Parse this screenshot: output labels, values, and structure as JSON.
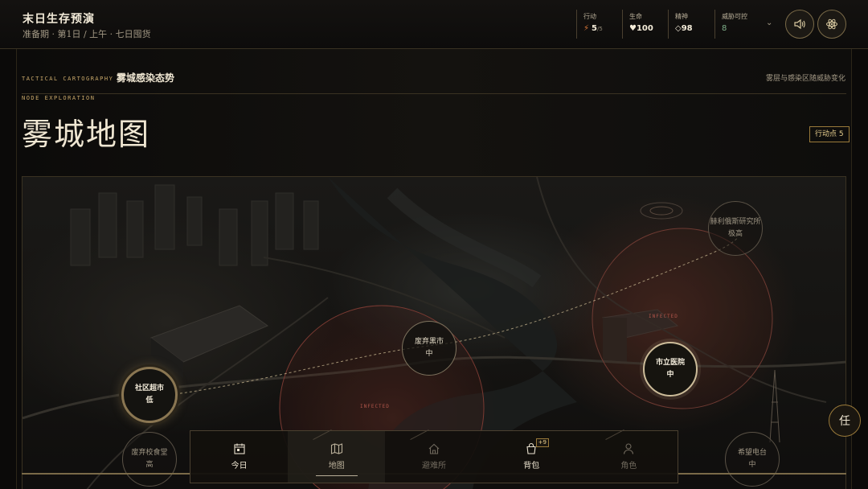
{
  "app": {
    "title": "末日生存预演",
    "subtitle": "准备期 · 第1日 / 上午 · 七日囤货"
  },
  "stats": [
    {
      "label": "行动",
      "value": "5",
      "max": "/5",
      "icon": "lightning-icon"
    },
    {
      "label": "生命",
      "value": "♥100"
    },
    {
      "label": "精神",
      "value": "◇98"
    },
    {
      "label": "威胁可控",
      "value": "8"
    }
  ],
  "header": {
    "kicker": "TACTICAL CARTOGRAPHY",
    "section_title": "雾城感染态势",
    "note": "雾层与感染区随威胁变化",
    "subkicker": "NODE EXPLORATION",
    "title": "雾城地图",
    "action_points": "行动点 5"
  },
  "map": {
    "infected_label": "INFECTED",
    "nodes": [
      {
        "name": "社区超市",
        "level": "低"
      },
      {
        "name": "废弃黑市",
        "level": "中"
      },
      {
        "name": "市立医院",
        "level": "中"
      },
      {
        "name": "赫利俄斯研究所",
        "level": "极高"
      },
      {
        "name": "废弃校食堂",
        "level": "高"
      },
      {
        "name": "希望电台",
        "level": "中"
      }
    ]
  },
  "nav": [
    {
      "label": "今日",
      "icon": "calendar-icon"
    },
    {
      "label": "地图",
      "icon": "map-icon"
    },
    {
      "label": "避难所",
      "icon": "house-icon"
    },
    {
      "label": "背包",
      "icon": "bag-icon",
      "badge": "+9"
    },
    {
      "label": "角色",
      "icon": "person-icon"
    }
  ],
  "task_button": "任",
  "colors": {
    "accent": "#c9a86a",
    "infected": "#b0554a",
    "safe": "#7fb08a"
  }
}
